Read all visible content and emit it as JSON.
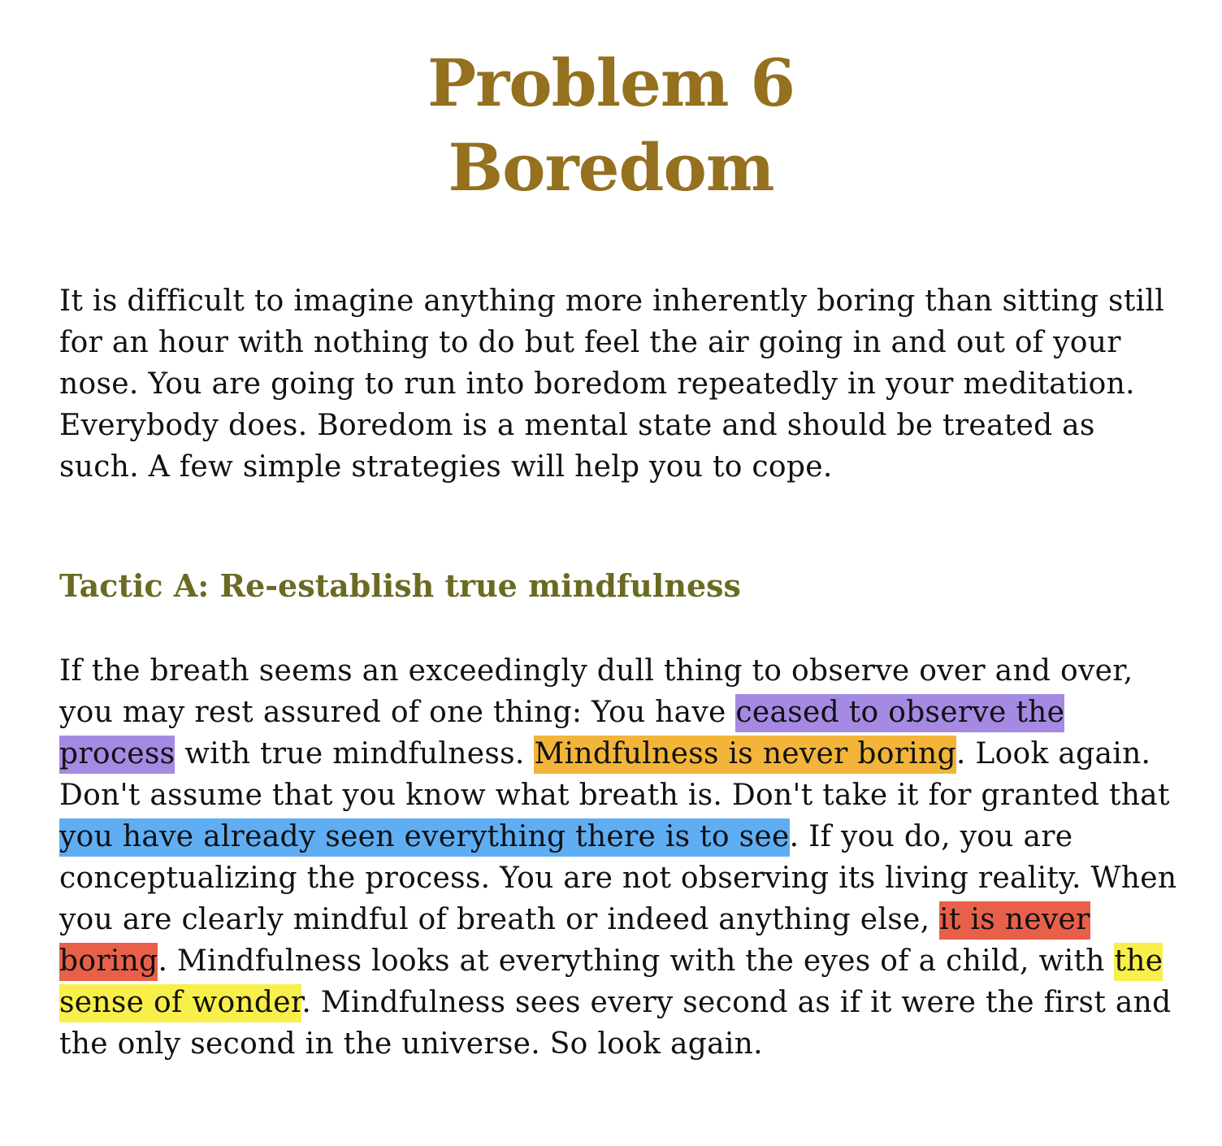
{
  "chapter": {
    "line1": "Problem 6",
    "line2": "Boredom"
  },
  "intro": {
    "text": "It is difficult to imagine anything more inherently boring than sitting still for an hour with nothing to do but feel the air going in and out of your nose. You are going to run into boredom repeatedly in your meditation. Everybody does. Boredom is a mental state and should be treated as such. A few simple strategies will help you to cope."
  },
  "tactic_a": {
    "heading": "Tactic A: Re-establish true mindfulness",
    "segments": [
      {
        "text": "If the breath seems an exceedingly dull thing to observe over and over, you may rest assured of one thing: You have ",
        "highlight": null
      },
      {
        "text": "ceased to observe the process",
        "highlight": "#a48ae3"
      },
      {
        "text": " with true mindfulness. ",
        "highlight": null
      },
      {
        "text": "Mindfulness is never boring",
        "highlight": "#f2b53a"
      },
      {
        "text": ". Look again. Don't assume that you know what breath is. Don't take it for granted that ",
        "highlight": null
      },
      {
        "text": "you have already seen everything there is to see",
        "highlight": "#5fadf3"
      },
      {
        "text": ". If you do, you are conceptualizing the process. You are not observing its living reality. When you are clearly mindful of breath or indeed anything else, ",
        "highlight": null
      },
      {
        "text": "it is never boring",
        "highlight": "#e8604a"
      },
      {
        "text": ". Mindfulness looks at everything with the eyes of a child, with ",
        "highlight": null
      },
      {
        "text": "the sense of wonder",
        "highlight": "#f8ef4a"
      },
      {
        "text": ". Mindfulness sees every second as if it were the first and the only second in the universe. So look again.",
        "highlight": null
      }
    ]
  }
}
